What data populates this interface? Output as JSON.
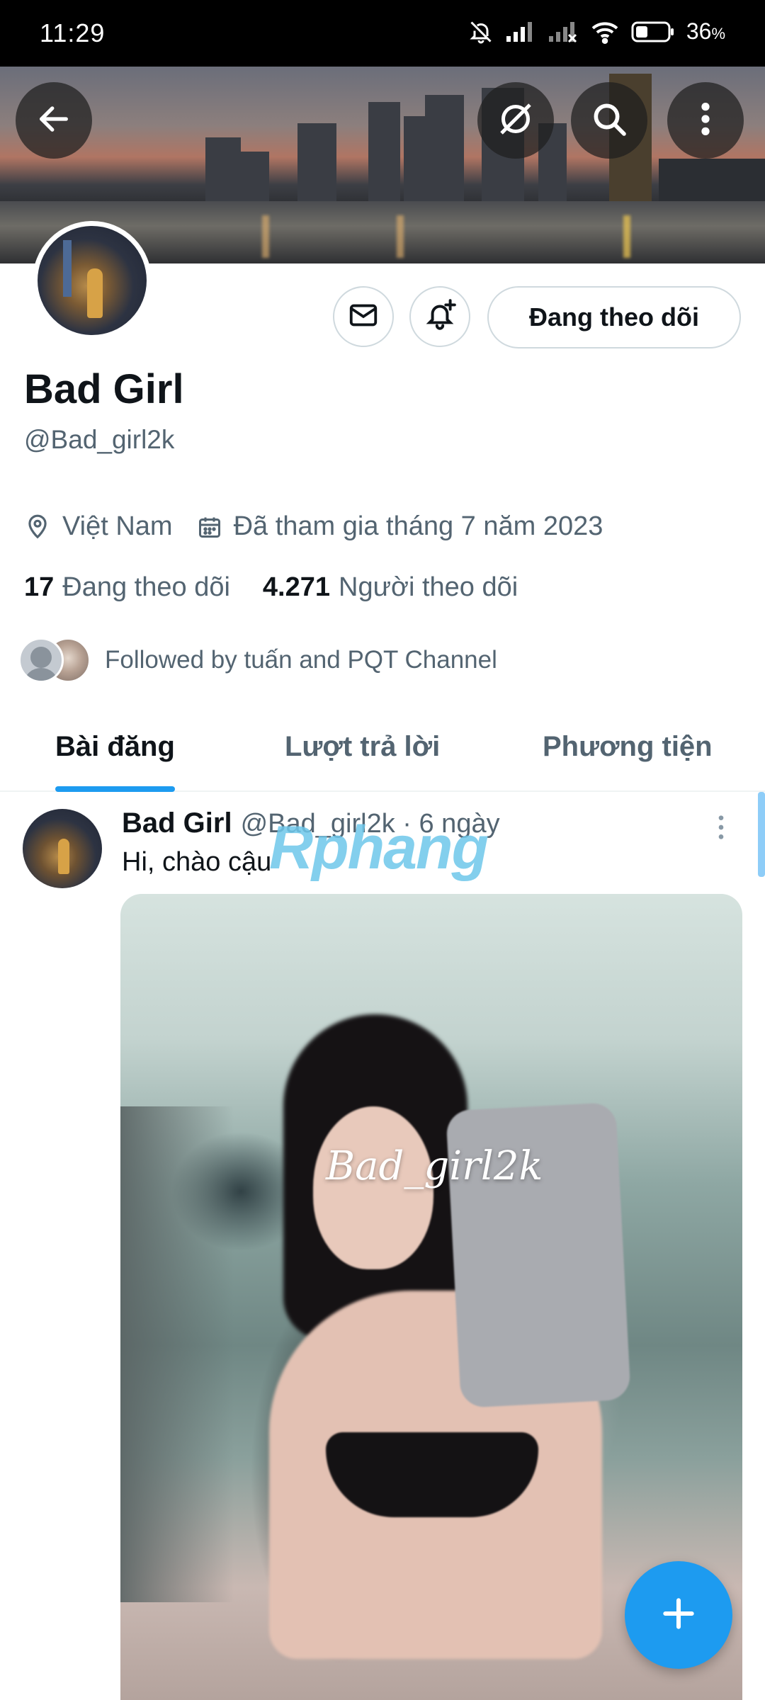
{
  "status_bar": {
    "time": "11:29",
    "battery": "36",
    "battery_unit": "%"
  },
  "profile": {
    "display_name": "Bad Girl",
    "handle": "@Bad_girl2k",
    "location": "Việt Nam",
    "joined": "Đã tham gia tháng 7 năm 2023",
    "following_count": "17",
    "following_label": "Đang theo dõi",
    "followers_count": "4.271",
    "followers_label": "Người theo dõi",
    "followed_by": "Followed by tuấn and PQT Channel",
    "follow_button": "Đang theo dõi"
  },
  "tabs": [
    {
      "label": "Bài đăng",
      "active": true
    },
    {
      "label": "Lượt trả lời",
      "active": false
    },
    {
      "label": "Phương tiện",
      "active": false
    }
  ],
  "post": {
    "name": "Bad Girl",
    "meta": "@Bad_girl2k · 6 ngày",
    "text": "Hi, chào cậu",
    "media_watermark": "Bad_girl2k"
  },
  "overlay_logo": {
    "text": "Rphang"
  },
  "colors": {
    "accent": "#1d9bf0",
    "secondary_text": "#536471",
    "primary_text": "#0f1419"
  },
  "icons": [
    "back-arrow-icon",
    "grok-icon",
    "search-icon",
    "more-vertical-icon",
    "mail-icon",
    "bell-plus-icon",
    "location-pin-icon",
    "calendar-icon",
    "plus-icon"
  ]
}
